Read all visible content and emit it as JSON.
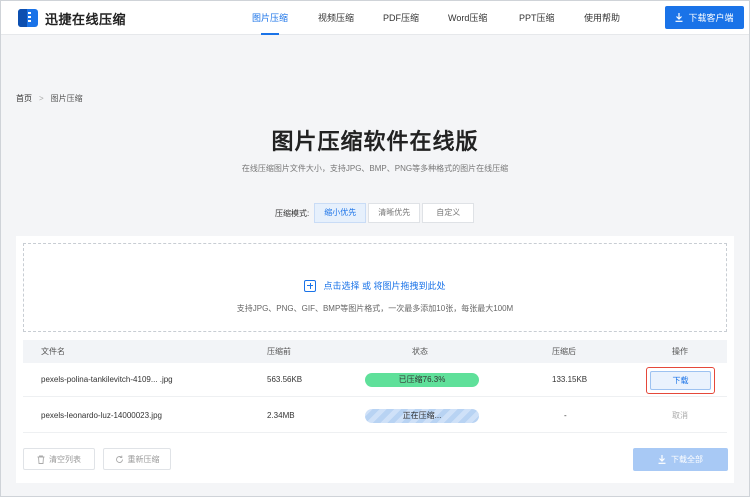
{
  "header": {
    "logo_text": "迅捷在线压缩",
    "nav": [
      {
        "label": "图片压缩",
        "active": true
      },
      {
        "label": "视频压缩",
        "active": false
      },
      {
        "label": "PDF压缩",
        "active": false
      },
      {
        "label": "Word压缩",
        "active": false
      },
      {
        "label": "PPT压缩",
        "active": false
      },
      {
        "label": "使用帮助",
        "active": false
      }
    ],
    "download_client": "下载客户端"
  },
  "breadcrumb": {
    "home": "首页",
    "separator": ">",
    "current": "图片压缩"
  },
  "page": {
    "title": "图片压缩软件在线版",
    "subtitle": "在线压缩图片文件大小，支持JPG、BMP、PNG等多种格式的图片在线压缩"
  },
  "mode": {
    "label": "压缩模式:",
    "options": [
      "缩小优先",
      "清晰优先",
      "自定义"
    ],
    "selected": "缩小优先"
  },
  "upload": {
    "action_text": "点击选择 或 将图片拖拽到此处",
    "hint": "支持JPG、PNG、GIF、BMP等图片格式，一次最多添加10张，每张最大100M"
  },
  "table": {
    "headers": {
      "filename": "文件名",
      "before": "压缩前",
      "status": "状态",
      "after": "压缩后",
      "action": "操作"
    },
    "rows": [
      {
        "filename": "pexels-polina-tankilevitch-4109... .jpg",
        "before": "563.56KB",
        "status": "已压缩76.3%",
        "after": "133.15KB",
        "action": "下载"
      },
      {
        "filename": "pexels-leonardo-luz-14000023.jpg",
        "before": "2.34MB",
        "status": "正在压缩...",
        "after": "-",
        "action": "取消"
      }
    ]
  },
  "footer": {
    "clear_list": "清空列表",
    "recompress": "重新压缩",
    "download_all": "下载全部"
  },
  "colors": {
    "accent": "#1a73e8",
    "done": "#5fe09a",
    "highlight": "#e5483a"
  }
}
